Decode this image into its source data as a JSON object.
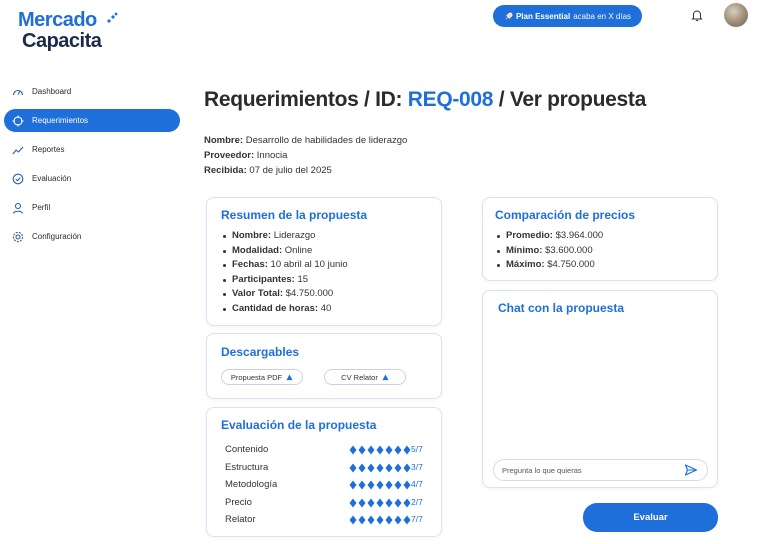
{
  "logo": {
    "line1": "Mercado",
    "line2": "Capacita"
  },
  "topbar": {
    "plan_bold": "Plan Essential",
    "plan_rest": "acaba en X días"
  },
  "sidebar": {
    "items": [
      {
        "label": "Dashboard",
        "icon": "speedometer-icon",
        "active": false
      },
      {
        "label": "Requerimientos",
        "icon": "crosshair-icon",
        "active": true
      },
      {
        "label": "Reportes",
        "icon": "line-chart-icon",
        "active": false
      },
      {
        "label": "Evaluación",
        "icon": "check-circle-icon",
        "active": false
      },
      {
        "label": "Perfil",
        "icon": "user-icon",
        "active": false
      },
      {
        "label": "Configuración",
        "icon": "gear-icon",
        "active": false
      }
    ]
  },
  "page": {
    "title_prefix": "Requerimientos / ID:",
    "title_id": "REQ-008",
    "title_suffix": "/ Ver propuesta"
  },
  "meta": {
    "name_label": "Nombre:",
    "name_value": "Desarrollo de habilidades de liderazgo",
    "provider_label": "Proveedor:",
    "provider_value": "Innocia",
    "received_label": "Recibida:",
    "received_value": "07 de julio del 2025"
  },
  "summary": {
    "title": "Resumen de la propuesta",
    "items": [
      {
        "label": "Nombre:",
        "value": "Liderazgo"
      },
      {
        "label": "Modalidad:",
        "value": "Online"
      },
      {
        "label": "Fechas:",
        "value": "10 abril al 10 junio"
      },
      {
        "label": "Participantes:",
        "value": "15"
      },
      {
        "label": "Valor Total:",
        "value": "$4.750.000"
      },
      {
        "label": "Cantidad de horas:",
        "value": "40"
      }
    ]
  },
  "downloads": {
    "title": "Descargables",
    "proposal_pdf": "Propuesta PDF",
    "cv_relator": "CV Relator"
  },
  "evaluation": {
    "title": "Evaluación de la propuesta",
    "rows": [
      {
        "label": "Contenido",
        "score": "5/7"
      },
      {
        "label": "Estructura",
        "score": "3/7"
      },
      {
        "label": "Metodología",
        "score": "4/7"
      },
      {
        "label": "Precio",
        "score": "2/7"
      },
      {
        "label": "Relator",
        "score": "7/7"
      }
    ]
  },
  "prices": {
    "title": "Comparación de precios",
    "items": [
      {
        "label": "Promedio:",
        "value": "$3.964.000"
      },
      {
        "label": "Mínimo:",
        "value": "$3.600.000"
      },
      {
        "label": "Máximo:",
        "value": "$4.750.000"
      }
    ]
  },
  "chat": {
    "title": "Chat con la propuesta",
    "placeholder": "Pregunta lo que quieras"
  },
  "actions": {
    "evaluate_label": "Evaluar"
  },
  "colors": {
    "accent": "#1e6fd9",
    "dark": "#1b2b4a"
  }
}
